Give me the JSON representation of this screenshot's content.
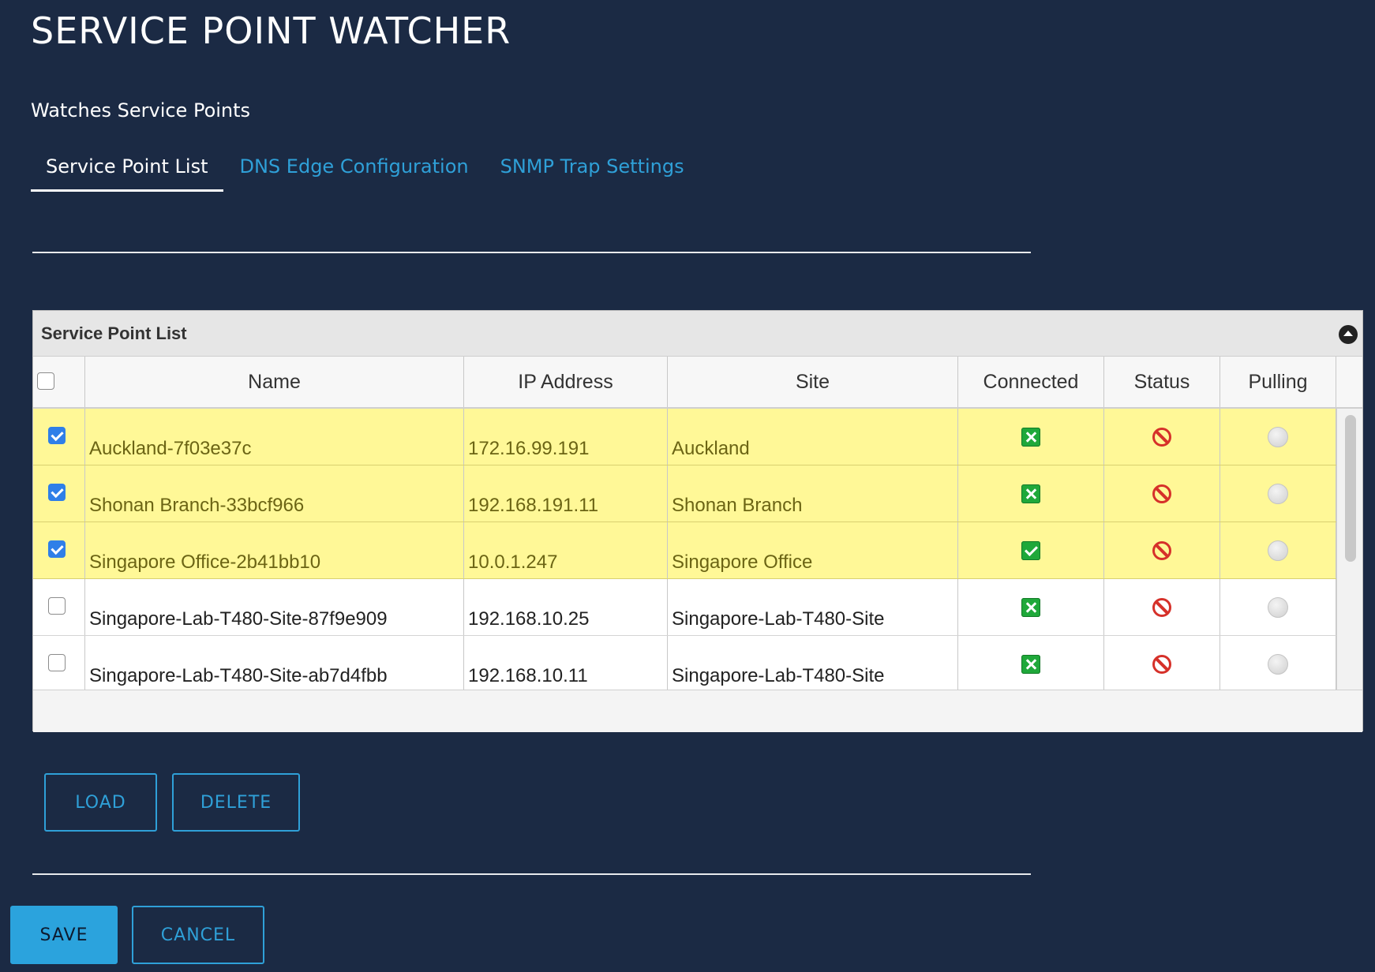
{
  "app": {
    "title": "SERVICE POINT WATCHER",
    "subtitle": "Watches Service Points"
  },
  "tabs": [
    {
      "label": "Service Point List",
      "active": true
    },
    {
      "label": "DNS Edge Configuration",
      "active": false
    },
    {
      "label": "SNMP Trap Settings",
      "active": false
    }
  ],
  "panel": {
    "title": "Service Point List",
    "columns": [
      "Name",
      "IP Address",
      "Site",
      "Connected",
      "Status",
      "Pulling"
    ],
    "rows": [
      {
        "checked": true,
        "name": "Auckland-7f03e37c",
        "ip": "172.16.99.191",
        "site": "Auckland",
        "connected": "x-icon",
        "status": "blocked-icon",
        "pulling": "grey-dot"
      },
      {
        "checked": true,
        "name": "Shonan Branch-33bcf966",
        "ip": "192.168.191.11",
        "site": "Shonan Branch",
        "connected": "x-icon",
        "status": "blocked-icon",
        "pulling": "grey-dot"
      },
      {
        "checked": true,
        "name": "Singapore Office-2b41bb10",
        "ip": "10.0.1.247",
        "site": "Singapore Office",
        "connected": "check-icon",
        "status": "blocked-icon",
        "pulling": "grey-dot"
      },
      {
        "checked": false,
        "name": "Singapore-Lab-T480-Site-87f9e909",
        "ip": "192.168.10.25",
        "site": "Singapore-Lab-T480-Site",
        "connected": "x-icon",
        "status": "blocked-icon",
        "pulling": "grey-dot"
      },
      {
        "checked": false,
        "name": "Singapore-Lab-T480-Site-ab7d4fbb",
        "ip": "192.168.10.11",
        "site": "Singapore-Lab-T480-Site",
        "connected": "x-icon",
        "status": "blocked-icon",
        "pulling": "grey-dot"
      }
    ]
  },
  "actions": {
    "load": "LOAD",
    "delete": "DELETE",
    "save": "SAVE",
    "cancel": "CANCEL"
  },
  "colors": {
    "background": "#1b2a44",
    "accent": "#2fa0d8",
    "selected_row": "#fff897",
    "connected": "#1fa83a",
    "status_blocked": "#d6312a"
  }
}
